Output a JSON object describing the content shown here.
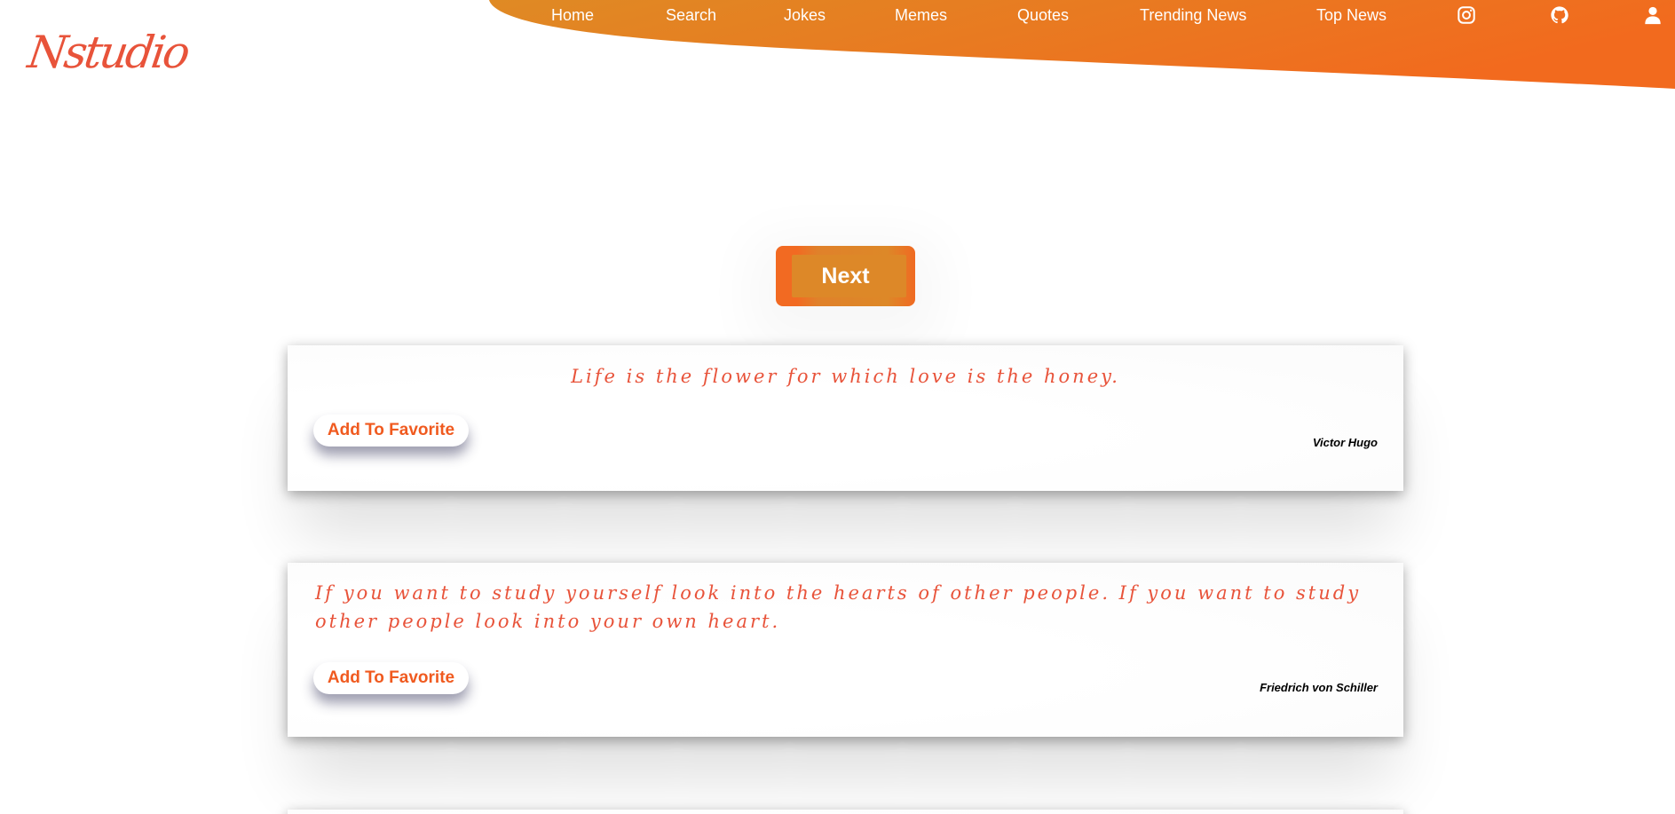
{
  "brand": {
    "logo_text": "Nstudio",
    "accent_color": "#f06a22",
    "text_accent_color": "#e8533a"
  },
  "nav": {
    "items": [
      {
        "label": "Home"
      },
      {
        "label": "Search"
      },
      {
        "label": "Jokes"
      },
      {
        "label": "Memes"
      },
      {
        "label": "Quotes"
      },
      {
        "label": "Trending News"
      },
      {
        "label": "Top News"
      }
    ],
    "icons": [
      "instagram-icon",
      "github-icon",
      "user-icon"
    ]
  },
  "main": {
    "next_label": "Next",
    "quotes": [
      {
        "text": "Life is the flower for which love is the honey.",
        "author": "Victor Hugo",
        "button_label": "Add To Favorite"
      },
      {
        "text": "If you want to study yourself look into the hearts of other people. If you want to study other people look into your own heart.",
        "author": "Friedrich von Schiller",
        "button_label": "Add To Favorite"
      }
    ]
  }
}
